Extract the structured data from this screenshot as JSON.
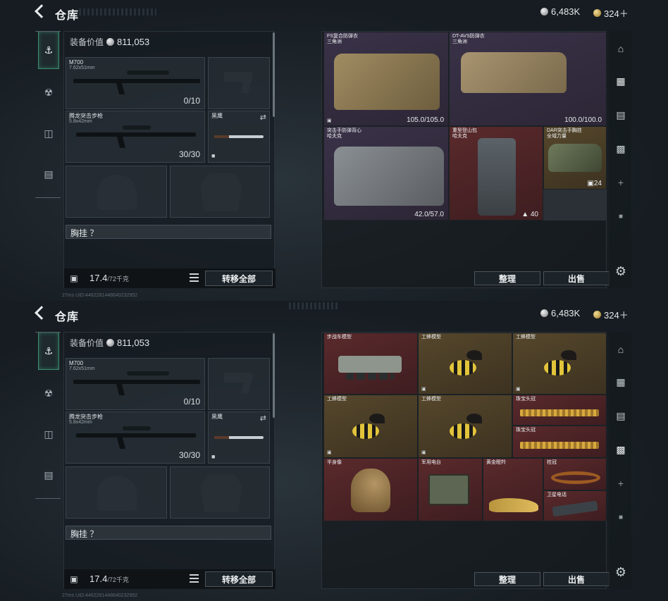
{
  "header": {
    "title": "仓库",
    "silver": "6,483K",
    "gold": "324＋"
  },
  "rail": {
    "items": [
      "weapon-icon",
      "helmet-icon",
      "backpack-icon",
      "medkit-icon"
    ]
  },
  "loadout": {
    "equip_label": "装备价值",
    "equip_value": "811,053",
    "primary": {
      "name": "M700",
      "caliber": "7.62x51mm",
      "ammo": "0/10"
    },
    "secondary": {
      "name": "腾龙突击步枪",
      "caliber": "5.8x42mm",
      "ammo": "30/30"
    },
    "melee": {
      "name": "黑鹰"
    },
    "chest_label": "胸挂 ？",
    "weight": "17.4",
    "weight_unit": "/72千克",
    "transfer_label": "转移全部"
  },
  "storage_top": {
    "items": [
      {
        "name": "FS复合防弹衣\n三角洲",
        "value": "105.0/105.0",
        "color": "purple"
      },
      {
        "name": "DT-AVS防弹衣\n三角洲",
        "value": "100.0/100.0",
        "color": "purple"
      },
      {
        "name": "突击手防弹背心\n哈夫克",
        "value": "42.0/57.0",
        "color": "purple"
      },
      {
        "name": "重型登山包\n哈夫克",
        "value": "40",
        "color": "red"
      },
      {
        "name": "DAR突击手胸挂\n全域力量",
        "value": "24",
        "color": "gold"
      }
    ]
  },
  "storage_bottom": {
    "items": [
      {
        "name": "步战车模型",
        "color": "red"
      },
      {
        "name": "工蜂模型",
        "color": "gold"
      },
      {
        "name": "工蜂模型",
        "color": "gold"
      },
      {
        "name": "工蜂模型",
        "color": "gold"
      },
      {
        "name": "工蜂模型",
        "color": "gold"
      },
      {
        "name": "珠宝头冠",
        "color": "red"
      },
      {
        "name": "珠宝头冠",
        "color": "red"
      },
      {
        "name": "半身像",
        "color": "red"
      },
      {
        "name": "军用电台",
        "color": "red"
      },
      {
        "name": "黄金瞪羚",
        "color": "red"
      },
      {
        "name": "桂冠",
        "color": "red"
      },
      {
        "name": "卫星电话",
        "color": "red"
      }
    ]
  },
  "actions": {
    "sort_label": "整理",
    "sell_label": "出售"
  },
  "footer": {
    "network": "27ms  UID:4462281448640232952"
  },
  "colors": {
    "accent": "#3e8a6e",
    "purple": "#3a3248",
    "red": "#5a2a2c",
    "gold": "#56472c"
  }
}
